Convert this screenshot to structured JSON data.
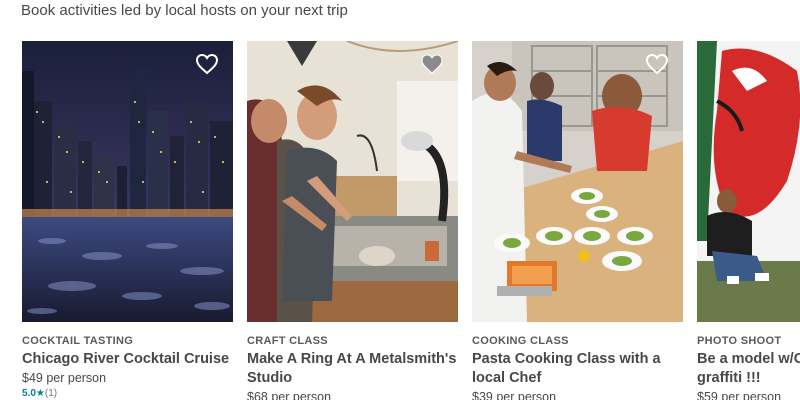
{
  "header": {
    "subtitle": "Book activities led by local hosts on your next trip"
  },
  "cards": [
    {
      "category": "COCKTAIL TASTING",
      "title": "Chicago River Cocktail Cruise",
      "price": "$49 per person",
      "rating": {
        "score": "5.0",
        "star": "★",
        "count": "(1)"
      },
      "favorite_icon": "heart-outline-icon",
      "image": "night-city-river-photo"
    },
    {
      "category": "CRAFT CLASS",
      "title": "Make A Ring At A Metalsmith's Studio",
      "price": "$68 per person",
      "favorite_icon": "heart-filled-icon",
      "image": "metalsmith-workshop-photo"
    },
    {
      "category": "COOKING CLASS",
      "title": "Pasta Cooking Class with a local Chef",
      "price": "$39 per person",
      "favorite_icon": "heart-outline-icon",
      "image": "pasta-kitchen-photo"
    },
    {
      "category": "PHOTO SHOOT",
      "title": "Be a model w/C graffiti !!!",
      "price": "$59 per person",
      "image": "graffiti-wall-photo"
    }
  ],
  "colors": {
    "text": "#484848",
    "accent": "#008489",
    "heart_outline": "#ffffff",
    "heart_filled": "#8a8a8a"
  }
}
